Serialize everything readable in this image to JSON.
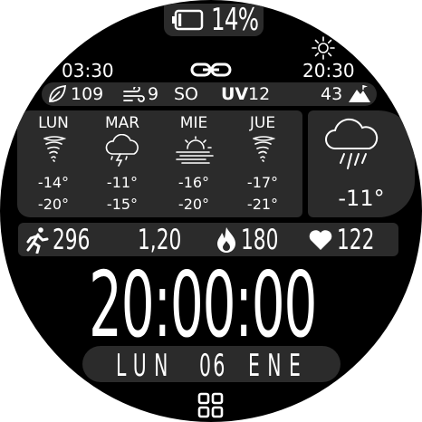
{
  "battery": {
    "percent_text": "14%",
    "level": 0.14,
    "icon": "battery-icon"
  },
  "header": {
    "time_left": "03:30",
    "time_right": "20:30",
    "link_icon": "link-icon",
    "sun_icon": "sun-icon"
  },
  "status": {
    "leaf_value": "109",
    "wind_value": "9",
    "wind_dir": "SO",
    "uv_label": "UV",
    "uv_value": "12",
    "alt_value": "43",
    "icons": [
      "leaf-icon",
      "wind-icon",
      "mountain-icon"
    ]
  },
  "forecast": [
    {
      "day": "LUN",
      "icon": "tornado-icon",
      "high": "-14°",
      "low": "-20°"
    },
    {
      "day": "MAR",
      "icon": "thunderstorm-icon",
      "high": "-11°",
      "low": "-15°"
    },
    {
      "day": "MIE",
      "icon": "fog-sun-icon",
      "high": "-16°",
      "low": "-20°"
    },
    {
      "day": "JUE",
      "icon": "tornado-icon",
      "high": "-17°",
      "low": "-21°"
    }
  ],
  "current": {
    "icon": "rain-cloud-icon",
    "temp": "-11°"
  },
  "activity": {
    "steps": "296",
    "distance": "1,20",
    "calories": "180",
    "heart_rate": "122",
    "icons": [
      "runner-icon",
      "fire-icon",
      "heart-icon"
    ]
  },
  "clock": {
    "time": "20:00:00"
  },
  "date": {
    "weekday": "LUN",
    "day": "06",
    "month": "ENE"
  },
  "apps_icon": "apps-grid-icon",
  "colors": {
    "panel": "#2b2b2b",
    "text": "#ffffff",
    "background": "#000000"
  }
}
